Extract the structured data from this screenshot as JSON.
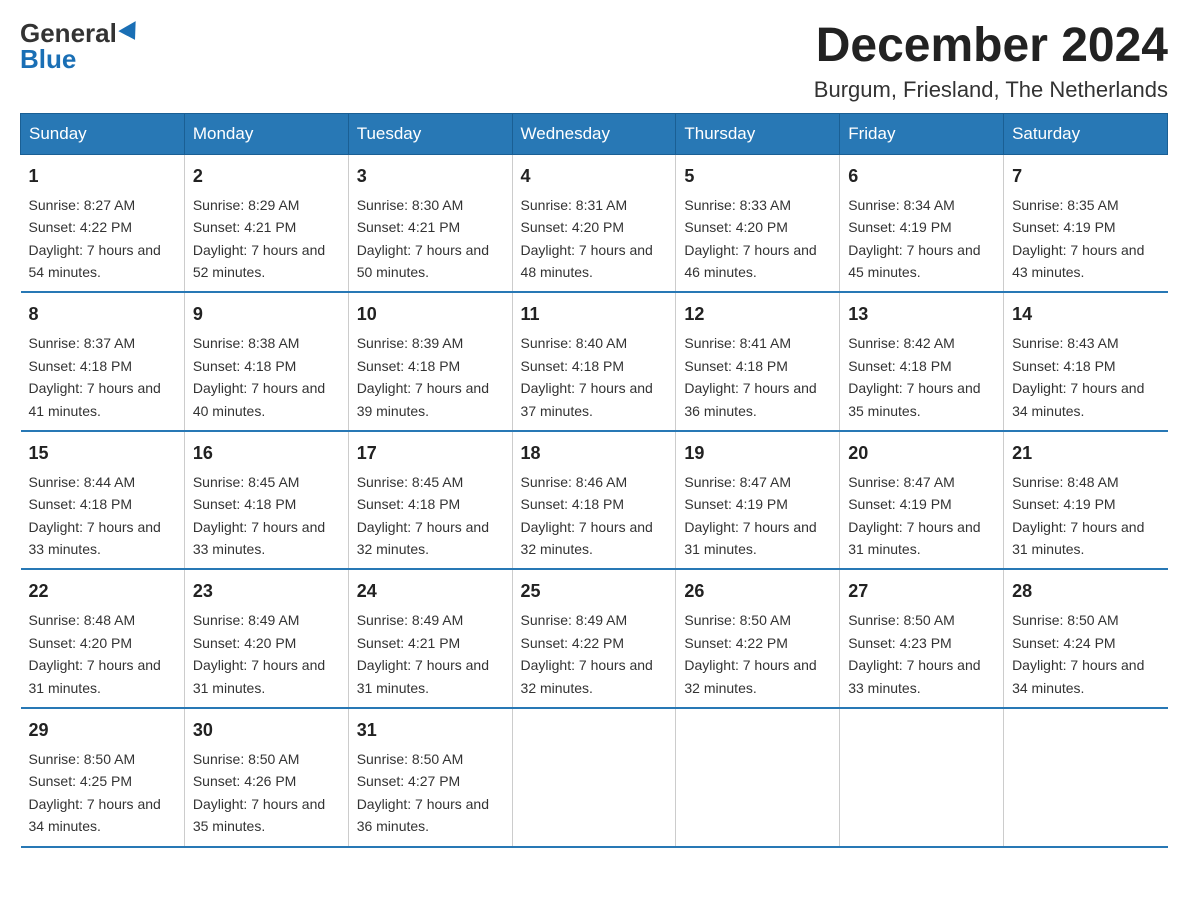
{
  "logo": {
    "general": "General",
    "blue": "Blue"
  },
  "title": {
    "month_year": "December 2024",
    "location": "Burgum, Friesland, The Netherlands"
  },
  "header": {
    "days": [
      "Sunday",
      "Monday",
      "Tuesday",
      "Wednesday",
      "Thursday",
      "Friday",
      "Saturday"
    ]
  },
  "weeks": [
    [
      {
        "day": "1",
        "sunrise": "8:27 AM",
        "sunset": "4:22 PM",
        "daylight": "7 hours and 54 minutes."
      },
      {
        "day": "2",
        "sunrise": "8:29 AM",
        "sunset": "4:21 PM",
        "daylight": "7 hours and 52 minutes."
      },
      {
        "day": "3",
        "sunrise": "8:30 AM",
        "sunset": "4:21 PM",
        "daylight": "7 hours and 50 minutes."
      },
      {
        "day": "4",
        "sunrise": "8:31 AM",
        "sunset": "4:20 PM",
        "daylight": "7 hours and 48 minutes."
      },
      {
        "day": "5",
        "sunrise": "8:33 AM",
        "sunset": "4:20 PM",
        "daylight": "7 hours and 46 minutes."
      },
      {
        "day": "6",
        "sunrise": "8:34 AM",
        "sunset": "4:19 PM",
        "daylight": "7 hours and 45 minutes."
      },
      {
        "day": "7",
        "sunrise": "8:35 AM",
        "sunset": "4:19 PM",
        "daylight": "7 hours and 43 minutes."
      }
    ],
    [
      {
        "day": "8",
        "sunrise": "8:37 AM",
        "sunset": "4:18 PM",
        "daylight": "7 hours and 41 minutes."
      },
      {
        "day": "9",
        "sunrise": "8:38 AM",
        "sunset": "4:18 PM",
        "daylight": "7 hours and 40 minutes."
      },
      {
        "day": "10",
        "sunrise": "8:39 AM",
        "sunset": "4:18 PM",
        "daylight": "7 hours and 39 minutes."
      },
      {
        "day": "11",
        "sunrise": "8:40 AM",
        "sunset": "4:18 PM",
        "daylight": "7 hours and 37 minutes."
      },
      {
        "day": "12",
        "sunrise": "8:41 AM",
        "sunset": "4:18 PM",
        "daylight": "7 hours and 36 minutes."
      },
      {
        "day": "13",
        "sunrise": "8:42 AM",
        "sunset": "4:18 PM",
        "daylight": "7 hours and 35 minutes."
      },
      {
        "day": "14",
        "sunrise": "8:43 AM",
        "sunset": "4:18 PM",
        "daylight": "7 hours and 34 minutes."
      }
    ],
    [
      {
        "day": "15",
        "sunrise": "8:44 AM",
        "sunset": "4:18 PM",
        "daylight": "7 hours and 33 minutes."
      },
      {
        "day": "16",
        "sunrise": "8:45 AM",
        "sunset": "4:18 PM",
        "daylight": "7 hours and 33 minutes."
      },
      {
        "day": "17",
        "sunrise": "8:45 AM",
        "sunset": "4:18 PM",
        "daylight": "7 hours and 32 minutes."
      },
      {
        "day": "18",
        "sunrise": "8:46 AM",
        "sunset": "4:18 PM",
        "daylight": "7 hours and 32 minutes."
      },
      {
        "day": "19",
        "sunrise": "8:47 AM",
        "sunset": "4:19 PM",
        "daylight": "7 hours and 31 minutes."
      },
      {
        "day": "20",
        "sunrise": "8:47 AM",
        "sunset": "4:19 PM",
        "daylight": "7 hours and 31 minutes."
      },
      {
        "day": "21",
        "sunrise": "8:48 AM",
        "sunset": "4:19 PM",
        "daylight": "7 hours and 31 minutes."
      }
    ],
    [
      {
        "day": "22",
        "sunrise": "8:48 AM",
        "sunset": "4:20 PM",
        "daylight": "7 hours and 31 minutes."
      },
      {
        "day": "23",
        "sunrise": "8:49 AM",
        "sunset": "4:20 PM",
        "daylight": "7 hours and 31 minutes."
      },
      {
        "day": "24",
        "sunrise": "8:49 AM",
        "sunset": "4:21 PM",
        "daylight": "7 hours and 31 minutes."
      },
      {
        "day": "25",
        "sunrise": "8:49 AM",
        "sunset": "4:22 PM",
        "daylight": "7 hours and 32 minutes."
      },
      {
        "day": "26",
        "sunrise": "8:50 AM",
        "sunset": "4:22 PM",
        "daylight": "7 hours and 32 minutes."
      },
      {
        "day": "27",
        "sunrise": "8:50 AM",
        "sunset": "4:23 PM",
        "daylight": "7 hours and 33 minutes."
      },
      {
        "day": "28",
        "sunrise": "8:50 AM",
        "sunset": "4:24 PM",
        "daylight": "7 hours and 34 minutes."
      }
    ],
    [
      {
        "day": "29",
        "sunrise": "8:50 AM",
        "sunset": "4:25 PM",
        "daylight": "7 hours and 34 minutes."
      },
      {
        "day": "30",
        "sunrise": "8:50 AM",
        "sunset": "4:26 PM",
        "daylight": "7 hours and 35 minutes."
      },
      {
        "day": "31",
        "sunrise": "8:50 AM",
        "sunset": "4:27 PM",
        "daylight": "7 hours and 36 minutes."
      },
      null,
      null,
      null,
      null
    ]
  ]
}
